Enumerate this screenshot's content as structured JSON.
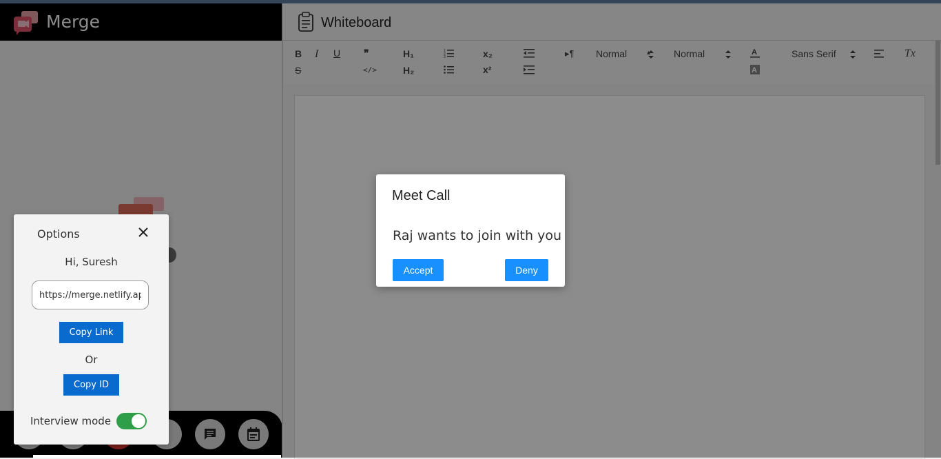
{
  "app": {
    "brand": "Merge"
  },
  "whiteboard": {
    "title": "Whiteboard"
  },
  "toolbar": {
    "bold": "B",
    "italic": "I",
    "underline": "U",
    "strike": "S",
    "blockquote": "❞",
    "code": "</>",
    "h1": "H₁",
    "h2": "H₂",
    "subscript": "x₂",
    "superscript": "x²",
    "size_select": "Normal",
    "header_select": "Normal",
    "font_select": "Sans Serif",
    "rtl": "▸¶",
    "clean": "Tx"
  },
  "options_panel": {
    "title": "Options",
    "greeting": "Hi, Suresh",
    "link_value": "https://merge.netlify.app",
    "copy_link": "Copy Link",
    "or": "Or",
    "copy_id": "Copy ID",
    "interview_mode_label": "Interview mode",
    "interview_mode_on": true
  },
  "dialog": {
    "title": "Meet Call",
    "message": "Raj wants to join with you",
    "accept": "Accept",
    "deny": "Deny"
  },
  "colors": {
    "primary": "#1890ff",
    "dark_blue": "#0a6bcf",
    "toggle_on": "#2e9e48"
  }
}
